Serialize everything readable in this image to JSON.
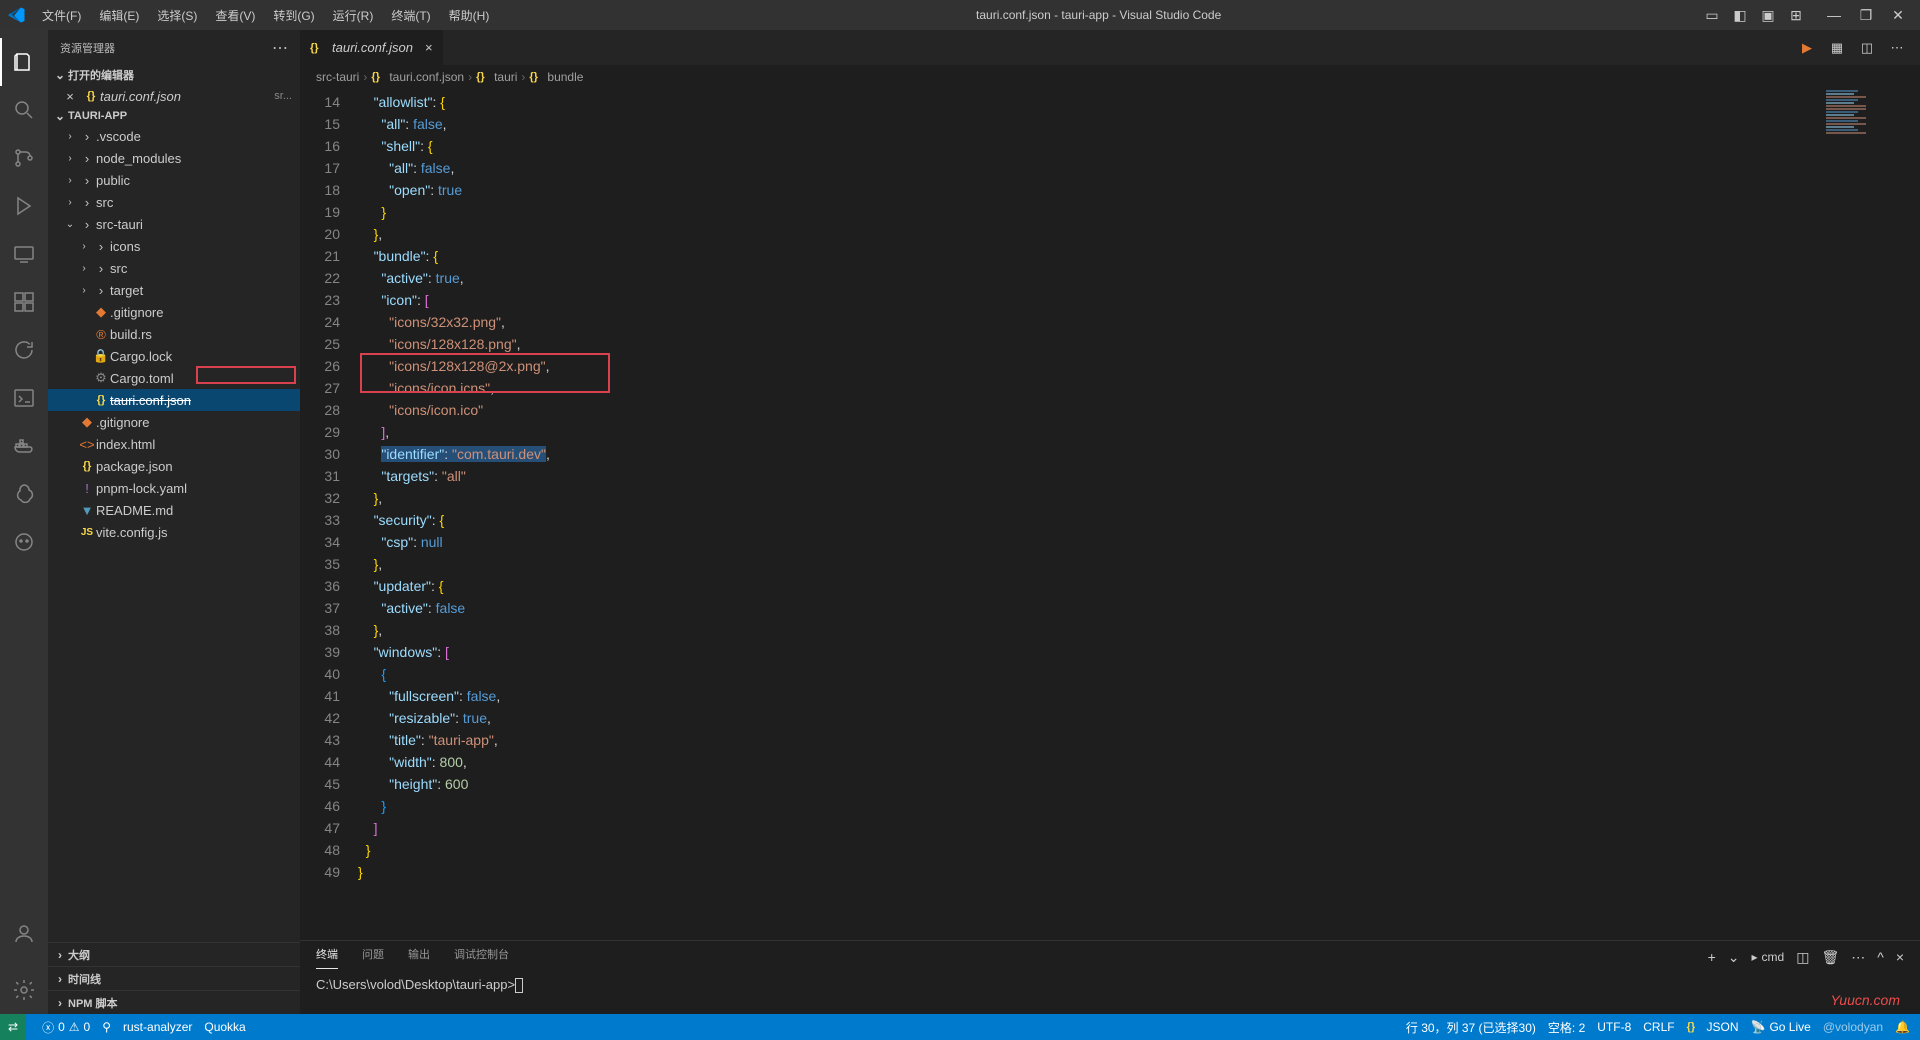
{
  "title": "tauri.conf.json - tauri-app - Visual Studio Code",
  "menubar": [
    "文件(F)",
    "编辑(E)",
    "选择(S)",
    "查看(V)",
    "转到(G)",
    "运行(R)",
    "终端(T)",
    "帮助(H)"
  ],
  "sidebar": {
    "header": "资源管理器",
    "open_editors": "打开的编辑器",
    "open_file": "tauri.conf.json",
    "open_file_path": "sr...",
    "project": "TAURI-APP",
    "tree": [
      {
        "label": ".vscode",
        "type": "folder",
        "indent": 1
      },
      {
        "label": "node_modules",
        "type": "folder",
        "indent": 1
      },
      {
        "label": "public",
        "type": "folder",
        "indent": 1
      },
      {
        "label": "src",
        "type": "folder",
        "indent": 1
      },
      {
        "label": "src-tauri",
        "type": "folder",
        "indent": 1,
        "expanded": true
      },
      {
        "label": "icons",
        "type": "folder",
        "indent": 2
      },
      {
        "label": "src",
        "type": "folder",
        "indent": 2
      },
      {
        "label": "target",
        "type": "folder",
        "indent": 2
      },
      {
        "label": ".gitignore",
        "type": "git",
        "indent": 2
      },
      {
        "label": "build.rs",
        "type": "rust",
        "indent": 2
      },
      {
        "label": "Cargo.lock",
        "type": "lock",
        "indent": 2
      },
      {
        "label": "Cargo.toml",
        "type": "toml",
        "indent": 2
      },
      {
        "label": "tauri.conf.json",
        "type": "json",
        "indent": 2,
        "active": true,
        "strike": true
      },
      {
        "label": ".gitignore",
        "type": "git",
        "indent": 1
      },
      {
        "label": "index.html",
        "type": "html",
        "indent": 1
      },
      {
        "label": "package.json",
        "type": "json",
        "indent": 1
      },
      {
        "label": "pnpm-lock.yaml",
        "type": "yaml",
        "indent": 1
      },
      {
        "label": "README.md",
        "type": "md",
        "indent": 1
      },
      {
        "label": "vite.config.js",
        "type": "js",
        "indent": 1
      }
    ],
    "outline": "大纲",
    "timeline": "时间线",
    "npm": "NPM 脚本"
  },
  "tab": {
    "label": "tauri.conf.json"
  },
  "breadcrumb": [
    "src-tauri",
    "tauri.conf.json",
    "tauri",
    "bundle"
  ],
  "code_lines": [
    {
      "n": 14,
      "tokens": [
        [
          "    ",
          ""
        ],
        [
          "\"allowlist\"",
          "key"
        ],
        [
          ": ",
          "punct"
        ],
        [
          "{",
          "brace"
        ]
      ]
    },
    {
      "n": 15,
      "tokens": [
        [
          "      ",
          ""
        ],
        [
          "\"all\"",
          "key"
        ],
        [
          ": ",
          "punct"
        ],
        [
          "false",
          "kw"
        ],
        [
          ",",
          "punct"
        ]
      ]
    },
    {
      "n": 16,
      "tokens": [
        [
          "      ",
          ""
        ],
        [
          "\"shell\"",
          "key"
        ],
        [
          ": ",
          "punct"
        ],
        [
          "{",
          "brace"
        ]
      ]
    },
    {
      "n": 17,
      "tokens": [
        [
          "        ",
          ""
        ],
        [
          "\"all\"",
          "key"
        ],
        [
          ": ",
          "punct"
        ],
        [
          "false",
          "kw"
        ],
        [
          ",",
          "punct"
        ]
      ]
    },
    {
      "n": 18,
      "tokens": [
        [
          "        ",
          ""
        ],
        [
          "\"open\"",
          "key"
        ],
        [
          ": ",
          "punct"
        ],
        [
          "true",
          "kw"
        ]
      ]
    },
    {
      "n": 19,
      "tokens": [
        [
          "      ",
          ""
        ],
        [
          "}",
          "brace"
        ]
      ]
    },
    {
      "n": 20,
      "tokens": [
        [
          "    ",
          ""
        ],
        [
          "}",
          "brace"
        ],
        [
          ",",
          "punct"
        ]
      ]
    },
    {
      "n": 21,
      "tokens": [
        [
          "    ",
          ""
        ],
        [
          "\"bundle\"",
          "key"
        ],
        [
          ": ",
          "punct"
        ],
        [
          "{",
          "brace"
        ]
      ]
    },
    {
      "n": 22,
      "tokens": [
        [
          "      ",
          ""
        ],
        [
          "\"active\"",
          "key"
        ],
        [
          ": ",
          "punct"
        ],
        [
          "true",
          "kw"
        ],
        [
          ",",
          "punct"
        ]
      ]
    },
    {
      "n": 23,
      "tokens": [
        [
          "      ",
          ""
        ],
        [
          "\"icon\"",
          "key"
        ],
        [
          ": ",
          "punct"
        ],
        [
          "[",
          "brace2"
        ]
      ]
    },
    {
      "n": 24,
      "tokens": [
        [
          "        ",
          ""
        ],
        [
          "\"icons/32x32.png\"",
          "str"
        ],
        [
          ",",
          "punct"
        ]
      ]
    },
    {
      "n": 25,
      "tokens": [
        [
          "        ",
          ""
        ],
        [
          "\"icons/128x128.png\"",
          "str"
        ],
        [
          ",",
          "punct"
        ]
      ]
    },
    {
      "n": 26,
      "tokens": [
        [
          "        ",
          ""
        ],
        [
          "\"icons/128x128@2x.png\"",
          "str"
        ],
        [
          ",",
          "punct"
        ]
      ]
    },
    {
      "n": 27,
      "tokens": [
        [
          "        ",
          ""
        ],
        [
          "\"icons/icon.icns\"",
          "str"
        ],
        [
          ",",
          "punct"
        ]
      ]
    },
    {
      "n": 28,
      "tokens": [
        [
          "        ",
          ""
        ],
        [
          "\"icons/icon.ico\"",
          "str"
        ]
      ]
    },
    {
      "n": 29,
      "tokens": [
        [
          "      ",
          ""
        ],
        [
          "]",
          "brace2"
        ],
        [
          ",",
          "punct"
        ]
      ]
    },
    {
      "n": 30,
      "tokens": [
        [
          "      ",
          ""
        ],
        [
          "\"identifier\"",
          "key sel"
        ],
        [
          ": ",
          "punct sel"
        ],
        [
          "\"com.tauri.dev\"",
          "str sel"
        ],
        [
          ",",
          "punct"
        ]
      ]
    },
    {
      "n": 31,
      "tokens": [
        [
          "      ",
          ""
        ],
        [
          "\"targets\"",
          "key"
        ],
        [
          ": ",
          "punct"
        ],
        [
          "\"all\"",
          "str"
        ]
      ]
    },
    {
      "n": 32,
      "tokens": [
        [
          "    ",
          ""
        ],
        [
          "}",
          "brace"
        ],
        [
          ",",
          "punct"
        ]
      ]
    },
    {
      "n": 33,
      "tokens": [
        [
          "    ",
          ""
        ],
        [
          "\"security\"",
          "key"
        ],
        [
          ": ",
          "punct"
        ],
        [
          "{",
          "brace"
        ]
      ]
    },
    {
      "n": 34,
      "tokens": [
        [
          "      ",
          ""
        ],
        [
          "\"csp\"",
          "key"
        ],
        [
          ": ",
          "punct"
        ],
        [
          "null",
          "kw"
        ]
      ]
    },
    {
      "n": 35,
      "tokens": [
        [
          "    ",
          ""
        ],
        [
          "}",
          "brace"
        ],
        [
          ",",
          "punct"
        ]
      ]
    },
    {
      "n": 36,
      "tokens": [
        [
          "    ",
          ""
        ],
        [
          "\"updater\"",
          "key"
        ],
        [
          ": ",
          "punct"
        ],
        [
          "{",
          "brace"
        ]
      ]
    },
    {
      "n": 37,
      "tokens": [
        [
          "      ",
          ""
        ],
        [
          "\"active\"",
          "key"
        ],
        [
          ": ",
          "punct"
        ],
        [
          "false",
          "kw"
        ]
      ]
    },
    {
      "n": 38,
      "tokens": [
        [
          "    ",
          ""
        ],
        [
          "}",
          "brace"
        ],
        [
          ",",
          "punct"
        ]
      ]
    },
    {
      "n": 39,
      "tokens": [
        [
          "    ",
          ""
        ],
        [
          "\"windows\"",
          "key"
        ],
        [
          ": ",
          "punct"
        ],
        [
          "[",
          "brace2"
        ]
      ]
    },
    {
      "n": 40,
      "tokens": [
        [
          "      ",
          ""
        ],
        [
          "{",
          "brace3"
        ]
      ]
    },
    {
      "n": 41,
      "tokens": [
        [
          "        ",
          ""
        ],
        [
          "\"fullscreen\"",
          "key"
        ],
        [
          ": ",
          "punct"
        ],
        [
          "false",
          "kw"
        ],
        [
          ",",
          "punct"
        ]
      ]
    },
    {
      "n": 42,
      "tokens": [
        [
          "        ",
          ""
        ],
        [
          "\"resizable\"",
          "key"
        ],
        [
          ": ",
          "punct"
        ],
        [
          "true",
          "kw"
        ],
        [
          ",",
          "punct"
        ]
      ]
    },
    {
      "n": 43,
      "tokens": [
        [
          "        ",
          ""
        ],
        [
          "\"title\"",
          "key"
        ],
        [
          ": ",
          "punct"
        ],
        [
          "\"tauri-app\"",
          "str"
        ],
        [
          ",",
          "punct"
        ]
      ]
    },
    {
      "n": 44,
      "tokens": [
        [
          "        ",
          ""
        ],
        [
          "\"width\"",
          "key"
        ],
        [
          ": ",
          "punct"
        ],
        [
          "800",
          "num"
        ],
        [
          ",",
          "punct"
        ]
      ]
    },
    {
      "n": 45,
      "tokens": [
        [
          "        ",
          ""
        ],
        [
          "\"height\"",
          "key"
        ],
        [
          ": ",
          "punct"
        ],
        [
          "600",
          "num"
        ]
      ]
    },
    {
      "n": 46,
      "tokens": [
        [
          "      ",
          ""
        ],
        [
          "}",
          "brace3"
        ]
      ]
    },
    {
      "n": 47,
      "tokens": [
        [
          "    ",
          ""
        ],
        [
          "]",
          "brace2"
        ]
      ]
    },
    {
      "n": 48,
      "tokens": [
        [
          "  ",
          ""
        ],
        [
          "}",
          "brace"
        ]
      ]
    },
    {
      "n": 49,
      "tokens": [
        [
          "}",
          "brace"
        ]
      ]
    }
  ],
  "terminal": {
    "tabs": [
      "终端",
      "问题",
      "输出",
      "调试控制台"
    ],
    "shell": "cmd",
    "prompt": "C:\\Users\\volod\\Desktop\\tauri-app>"
  },
  "statusbar": {
    "errors": "0",
    "warnings": "0",
    "rust": "rust-analyzer",
    "quokka": "Quokka",
    "cursor": "行 30，列 37 (已选择30)",
    "spaces": "空格: 2",
    "encoding": "UTF-8",
    "eol": "CRLF",
    "lang": "JSON",
    "golive": "Go Live",
    "watermark_user": "@volodyan"
  },
  "watermark": "Yuucn.com"
}
